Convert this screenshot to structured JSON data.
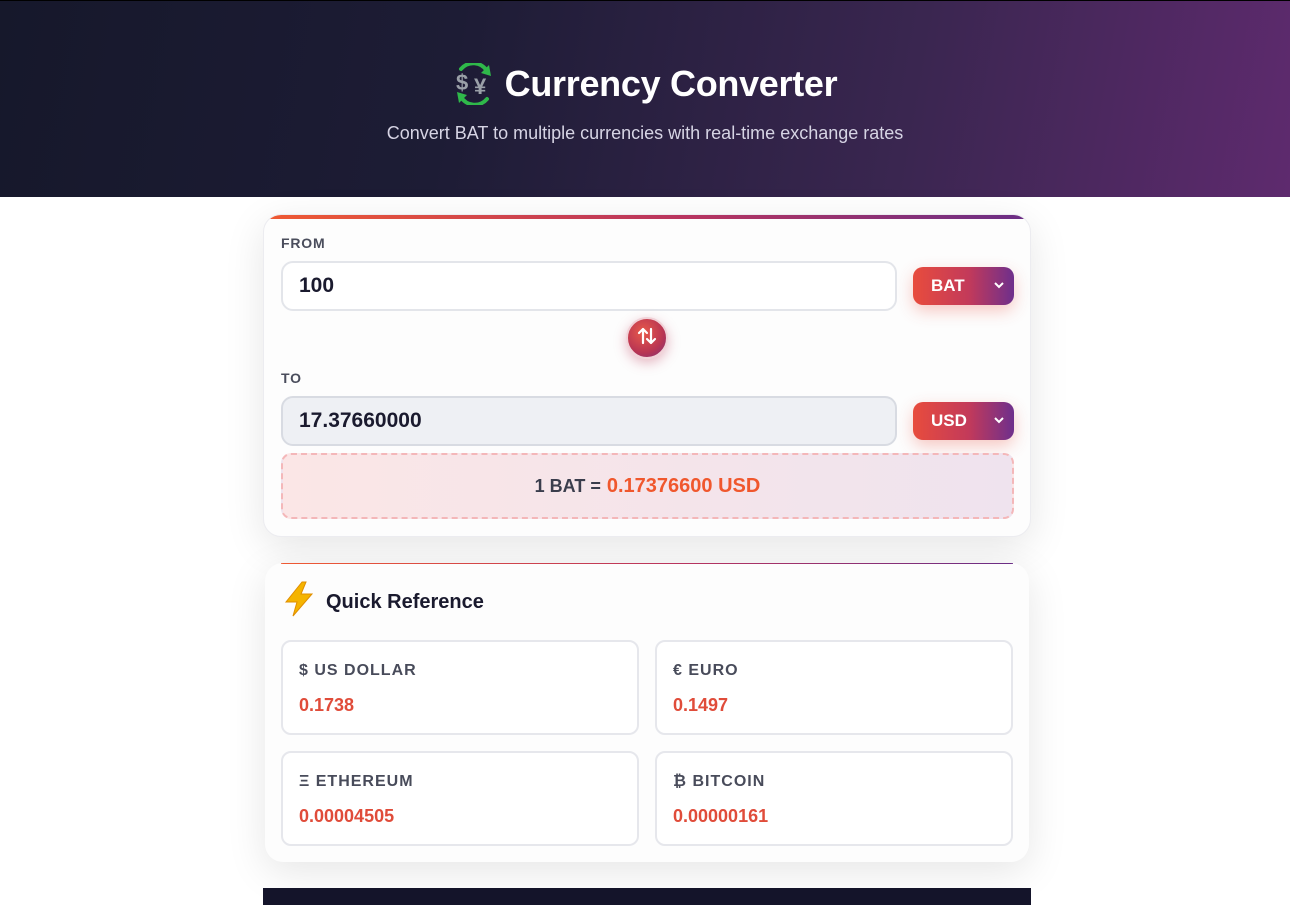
{
  "header": {
    "icon": "currency-exchange-icon",
    "title": "Currency Converter",
    "subtitle": "Convert BAT to multiple currencies with real-time exchange rates"
  },
  "converter": {
    "from_label": "FROM",
    "from_amount": "100",
    "from_currency": "BAT",
    "to_label": "TO",
    "to_amount": "17.37660000",
    "to_currency": "USD",
    "rate_prefix": "1 BAT =",
    "rate_value": "0.17376600 USD"
  },
  "reference": {
    "icon": "lightning-icon",
    "title": "Quick Reference",
    "items": [
      {
        "name": "$ US DOLLAR",
        "value": "0.1738"
      },
      {
        "name": "€ EURO",
        "value": "0.1497"
      },
      {
        "name": "Ξ ETHEREUM",
        "value": "0.00004505"
      },
      {
        "name": "₿ BITCOIN",
        "value": "0.00000161"
      }
    ]
  },
  "colors": {
    "accent": "#e84c3d",
    "accent_purple": "#6e2f8c",
    "hero_dark": "#16182b",
    "value_text": "#e04c3a"
  }
}
